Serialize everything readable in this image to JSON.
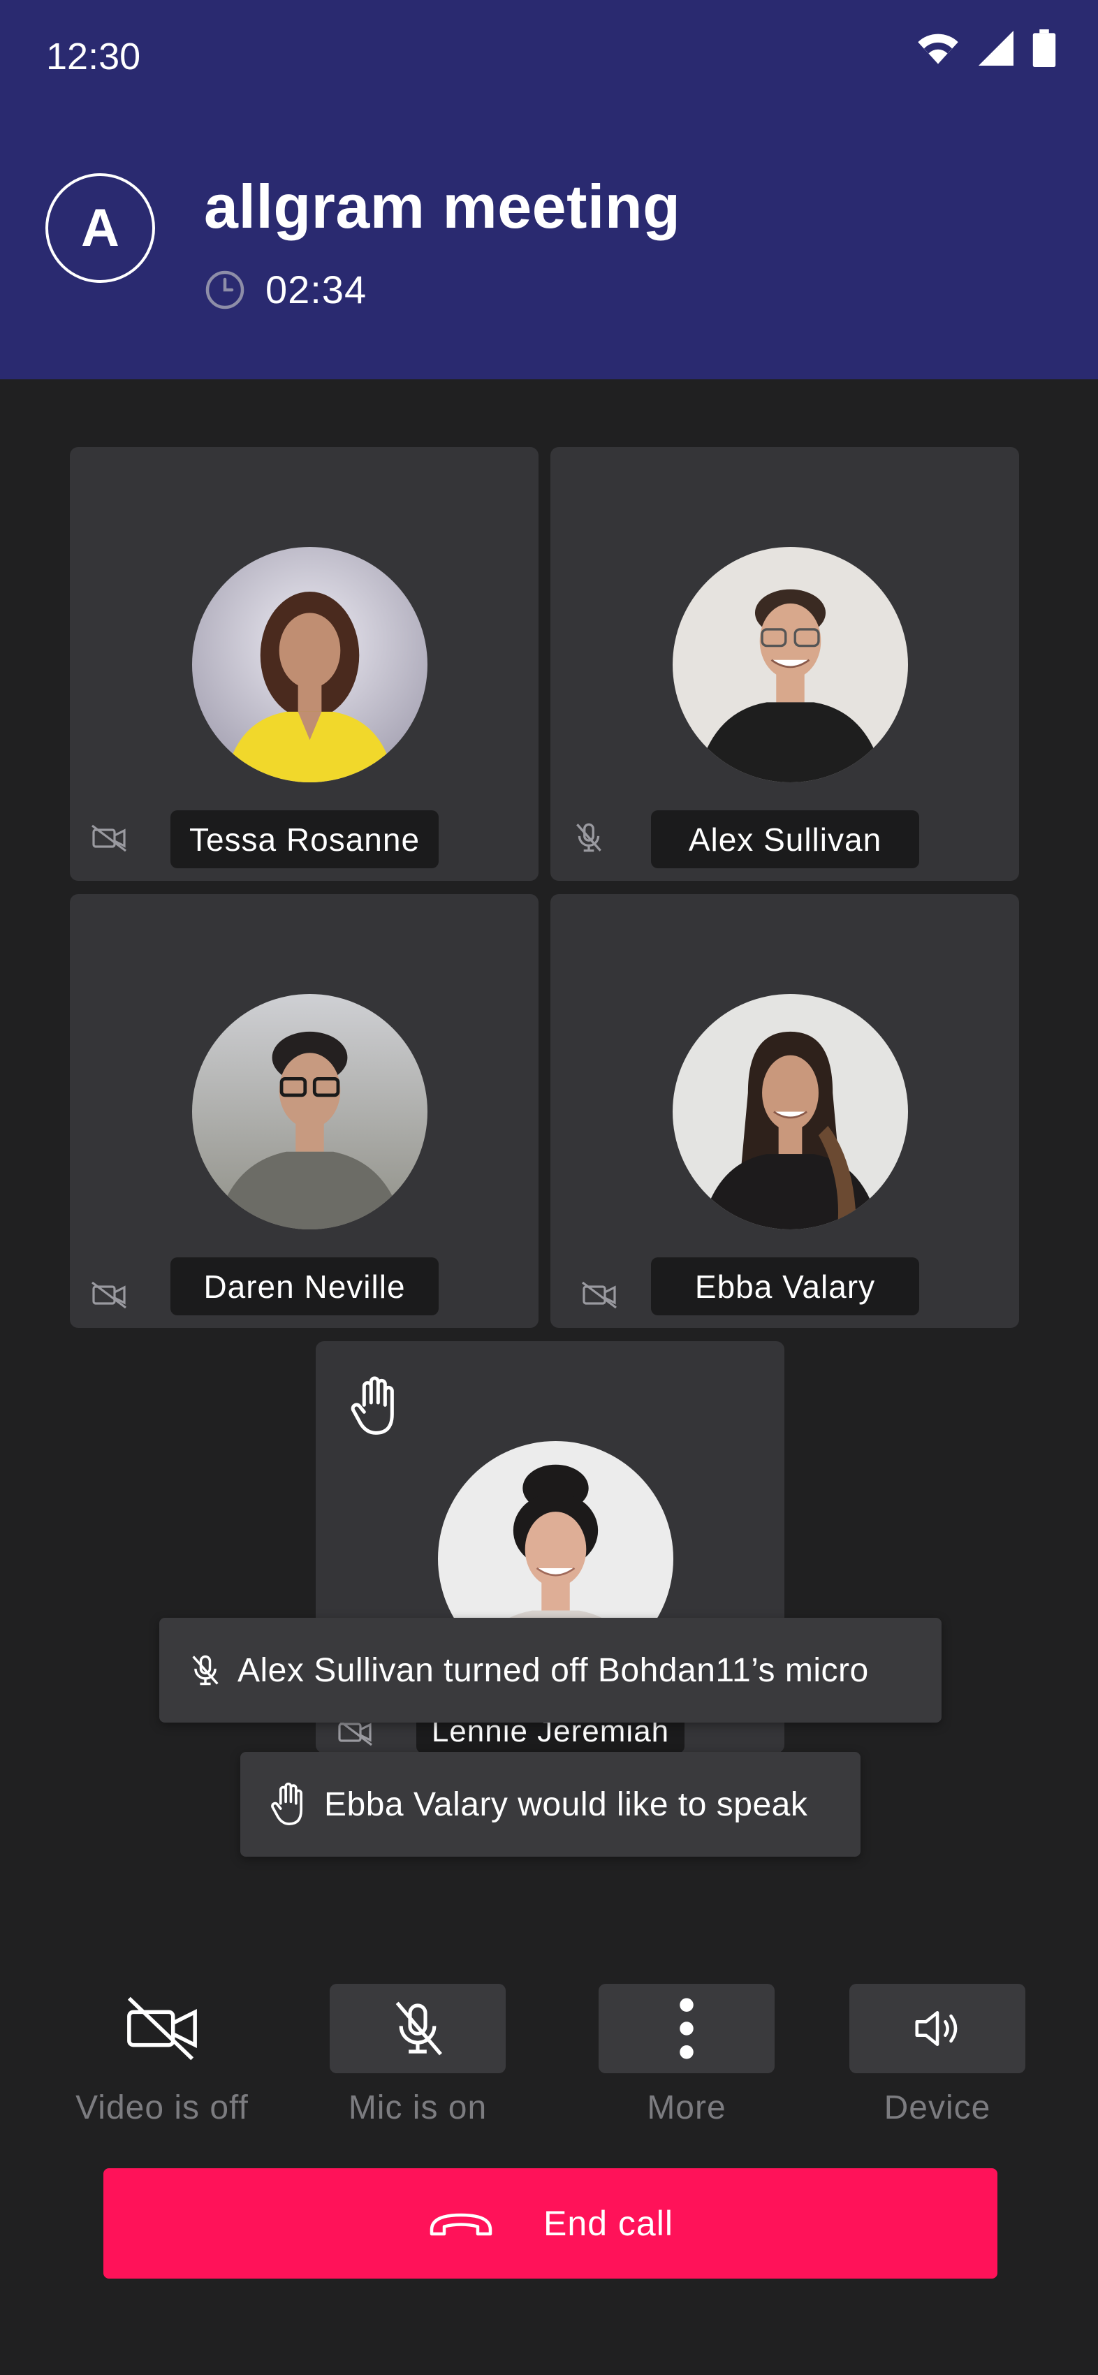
{
  "status_bar": {
    "time": "12:30",
    "icons": [
      "wifi-icon",
      "signal-icon",
      "battery-icon"
    ]
  },
  "header": {
    "avatar_letter": "A",
    "title": "allgram meeting",
    "timer": "02:34",
    "timer_icon": "clock-icon",
    "background": "#2a2a70"
  },
  "participants": [
    {
      "name": "Tessa Rosanne",
      "status_icon": "video-off-icon"
    },
    {
      "name": "Alex Sullivan",
      "status_icon": "mic-off-icon"
    },
    {
      "name": "Daren Neville",
      "status_icon": "video-off-icon"
    },
    {
      "name": "Ebba Valary",
      "status_icon": "video-off-icon"
    },
    {
      "name": "Lennie Jeremiah",
      "status_icon": "video-off-icon",
      "hand_raised": true
    }
  ],
  "toasts": [
    {
      "text": "Alex Sullivan turned off Bohdan11’s micro",
      "icon": "mic-off-icon"
    },
    {
      "text": "Ebba Valary would like to speak",
      "icon": "hand-icon"
    }
  ],
  "controls": {
    "video": {
      "label": "Video is off",
      "icon": "video-off-icon"
    },
    "mic": {
      "label": "Mic is on",
      "icon": "mic-off-icon"
    },
    "more": {
      "label": "More",
      "icon": "more-vertical-icon"
    },
    "device": {
      "label": "Device",
      "icon": "speaker-icon"
    }
  },
  "end_call": {
    "label": "End call",
    "icon": "phone-hangup-icon",
    "color": "#ff1259"
  }
}
